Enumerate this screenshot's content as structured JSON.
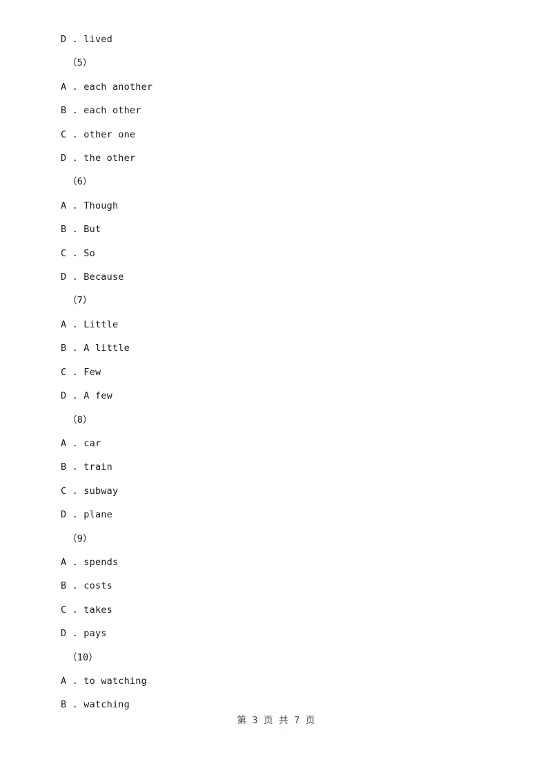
{
  "document": {
    "lines": [
      {
        "text": "D . lived",
        "type": "option"
      },
      {
        "text": "（5）",
        "type": "group"
      },
      {
        "text": "A . each another",
        "type": "option"
      },
      {
        "text": "B . each other",
        "type": "option"
      },
      {
        "text": "C . other one",
        "type": "option"
      },
      {
        "text": "D . the other",
        "type": "option"
      },
      {
        "text": "（6）",
        "type": "group"
      },
      {
        "text": "A . Though",
        "type": "option"
      },
      {
        "text": "B . But",
        "type": "option"
      },
      {
        "text": "C . So",
        "type": "option"
      },
      {
        "text": "D . Because",
        "type": "option"
      },
      {
        "text": "（7）",
        "type": "group"
      },
      {
        "text": "A . Little",
        "type": "option"
      },
      {
        "text": "B . A little",
        "type": "option"
      },
      {
        "text": "C . Few",
        "type": "option"
      },
      {
        "text": "D . A few",
        "type": "option"
      },
      {
        "text": "（8）",
        "type": "group"
      },
      {
        "text": "A . car",
        "type": "option"
      },
      {
        "text": "B . train",
        "type": "option"
      },
      {
        "text": "C . subway",
        "type": "option"
      },
      {
        "text": "D . plane",
        "type": "option"
      },
      {
        "text": "（9）",
        "type": "group"
      },
      {
        "text": "A . spends",
        "type": "option"
      },
      {
        "text": "B . costs",
        "type": "option"
      },
      {
        "text": "C . takes",
        "type": "option"
      },
      {
        "text": "D . pays",
        "type": "option"
      },
      {
        "text": "（10）",
        "type": "group"
      },
      {
        "text": "A . to watching",
        "type": "option"
      },
      {
        "text": "B . watching",
        "type": "option"
      }
    ],
    "footer": "第 3 页 共 7 页"
  }
}
